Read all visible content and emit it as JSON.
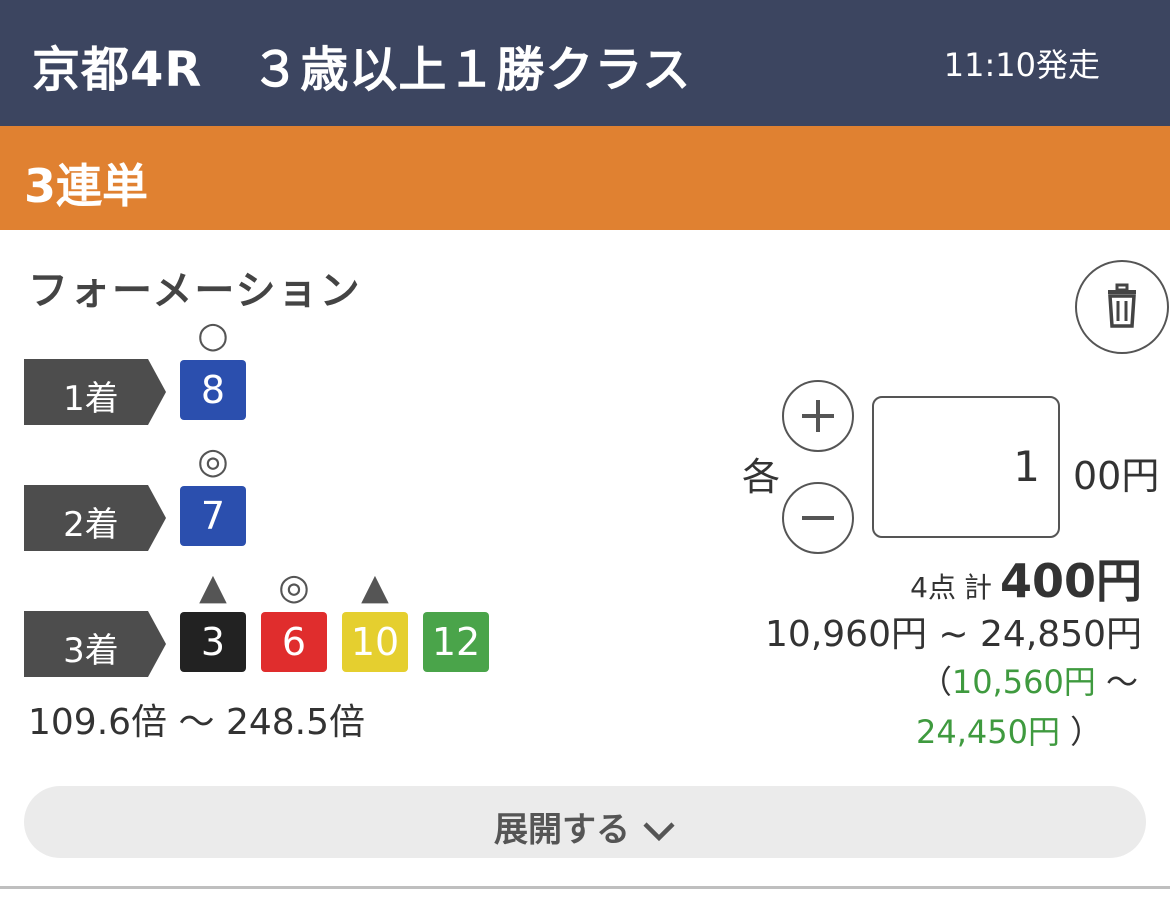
{
  "header": {
    "race_title": "京都4R　３歳以上１勝クラス",
    "post_time": "11:10発走"
  },
  "bet_type": "3連単",
  "method": "フォーメーション",
  "positions": [
    {
      "label": "1着",
      "horses": [
        {
          "number": "8",
          "mark": "○",
          "color": "#2b4fae"
        }
      ]
    },
    {
      "label": "2着",
      "horses": [
        {
          "number": "7",
          "mark": "◎",
          "color": "#2b4fae"
        }
      ]
    },
    {
      "label": "3着",
      "horses": [
        {
          "number": "3",
          "mark": "▲",
          "color": "#222222"
        },
        {
          "number": "6",
          "mark": "◎",
          "color": "#e02d2d"
        },
        {
          "number": "10",
          "mark": "▲",
          "color": "#e5cf2f"
        },
        {
          "number": "12",
          "mark": "",
          "color": "#4aa44a"
        }
      ]
    }
  ],
  "odds_range": "109.6倍 ～ 248.5倍",
  "amount": {
    "each_label": "各",
    "value": "1",
    "unit": "00円"
  },
  "summary": {
    "points": "4点",
    "total_label": "計",
    "total": "400円",
    "payout_range": "10,960円 ~ 24,850円",
    "net_open": "（",
    "net_min": "10,560円",
    "net_sep": "～",
    "net_max": "24,450円",
    "net_close": "）"
  },
  "expand_label": "展開する",
  "colors": {
    "header_bg": "#3c4560",
    "bet_type_bg": "#e08131",
    "profit_green": "#3f9a3f"
  },
  "icons": [
    "trash-icon",
    "plus-icon",
    "minus-icon",
    "chevron-down-icon"
  ]
}
